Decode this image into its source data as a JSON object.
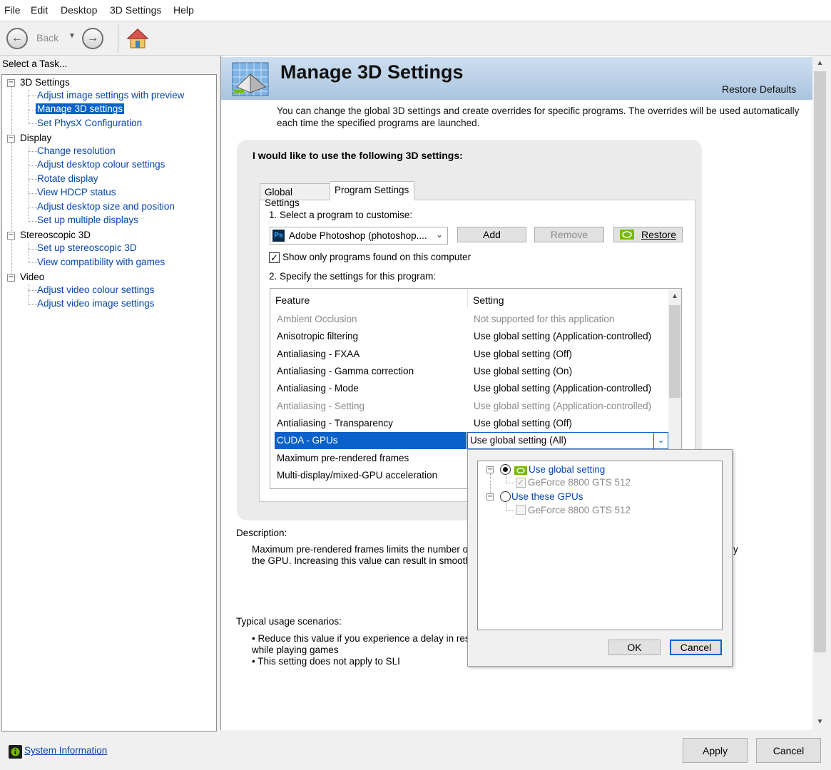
{
  "menu": [
    "File",
    "Edit",
    "Desktop",
    "3D Settings",
    "Help"
  ],
  "toolbar": {
    "back_label": "Back"
  },
  "task_panel": {
    "header": "Select a Task...",
    "categories": [
      {
        "label": "3D Settings",
        "items": [
          "Adjust image settings with preview",
          "Manage 3D settings",
          "Set PhysX Configuration"
        ]
      },
      {
        "label": "Display",
        "items": [
          "Change resolution",
          "Adjust desktop colour settings",
          "Rotate display",
          "View HDCP status",
          "Adjust desktop size and position",
          "Set up multiple displays"
        ]
      },
      {
        "label": "Stereoscopic 3D",
        "items": [
          "Set up stereoscopic 3D",
          "View compatibility with games"
        ]
      },
      {
        "label": "Video",
        "items": [
          "Adjust video colour settings",
          "Adjust video image settings"
        ]
      }
    ],
    "selected": "Manage 3D settings"
  },
  "page": {
    "title": "Manage 3D Settings",
    "restore_defaults": "Restore Defaults",
    "intro": "You can change the global 3D settings and create overrides for specific programs. The overrides will be used automatically each time the specified programs are launched.",
    "settings_heading": "I would like to use the following 3D settings:",
    "tabs": [
      "Global Settings",
      "Program Settings"
    ],
    "active_tab": "Program Settings",
    "step1_label": "1. Select a program to customise:",
    "program_selected": "Adobe Photoshop (photoshop....",
    "program_icon_text": "Ps",
    "add_button": "Add",
    "remove_button": "Remove",
    "restore_button": "Restore",
    "show_only_checkbox": "Show only programs found on this computer",
    "step2_label": "2. Specify the settings for this program:",
    "table_headers": {
      "feature": "Feature",
      "setting": "Setting"
    },
    "rows": [
      {
        "feature": "Ambient Occlusion",
        "setting": "Not supported for this application",
        "dim": true
      },
      {
        "feature": "Anisotropic filtering",
        "setting": "Use global setting (Application-controlled)",
        "dim": false
      },
      {
        "feature": "Antialiasing - FXAA",
        "setting": "Use global setting (Off)",
        "dim": false
      },
      {
        "feature": "Antialiasing - Gamma correction",
        "setting": "Use global setting (On)",
        "dim": false
      },
      {
        "feature": "Antialiasing - Mode",
        "setting": "Use global setting (Application-controlled)",
        "dim": false
      },
      {
        "feature": "Antialiasing - Setting",
        "setting": "Use global setting (Application-controlled)",
        "dim": true
      },
      {
        "feature": "Antialiasing - Transparency",
        "setting": "Use global setting (Off)",
        "dim": false
      },
      {
        "feature": "CUDA - GPUs",
        "setting": "Use global setting (All)",
        "dim": false,
        "selected": true
      },
      {
        "feature": "Maximum pre-rendered frames",
        "setting": "",
        "dim": false
      },
      {
        "feature": "Multi-display/mixed-GPU acceleration",
        "setting": "",
        "dim": false
      }
    ],
    "description_label": "Description:",
    "description_text_1": "Maximum pre-rendered frames limits the number of",
    "description_text_2": "the GPU. Increasing this value can result in smoothe",
    "description_tail": "y",
    "usage_label": "Typical usage scenarios:",
    "usage_1a": "Reduce this value if you experience a delay in resp",
    "usage_1b": "while playing games",
    "usage_2": "This setting does not apply to SLI"
  },
  "gpu_popup": {
    "use_global": "Use global setting",
    "global_gpu": "GeForce 8800 GTS 512",
    "use_these": "Use these GPUs",
    "these_gpu": "GeForce 8800 GTS 512",
    "ok": "OK",
    "cancel": "Cancel"
  },
  "footer": {
    "system_information": "System Information",
    "apply": "Apply",
    "cancel": "Cancel"
  },
  "colors": {
    "selection_blue": "#0a61c9",
    "link_blue": "#0645ad",
    "nvidia_green": "#76b900",
    "header_band": "#b8cfe6"
  }
}
